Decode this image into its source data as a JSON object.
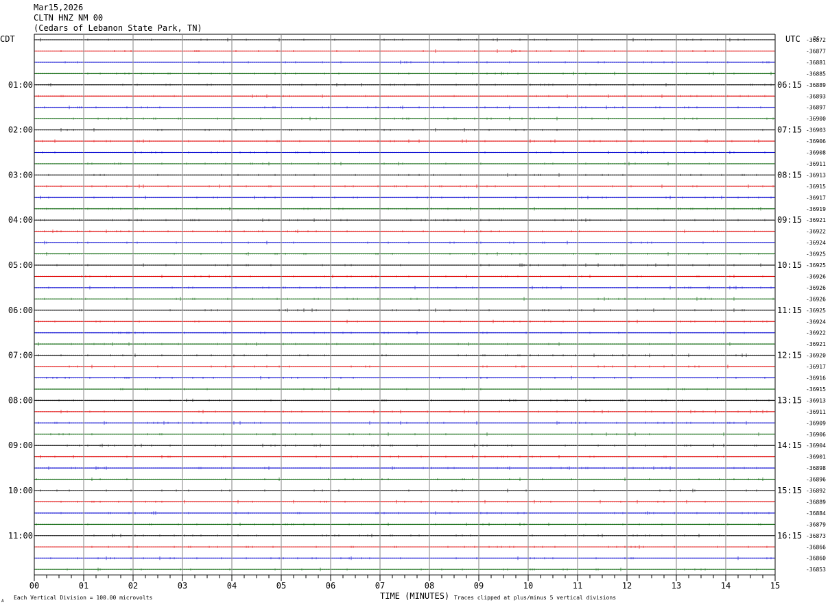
{
  "header": {
    "date": "Mar15,2026",
    "station": "CLTN HNZ NM 00",
    "location": "(Cedars of Lebanon State Park, TN)"
  },
  "labels": {
    "left_tz": "CDT",
    "right_tz": "UTC",
    "dc": "DC",
    "xlabel": "TIME (MINUTES)",
    "scale_note": "Each Vertical Division =  100.00 microvolts",
    "clip_note": "Traces clipped at plus/minus 5 vertical divisions",
    "corner_mark": "A"
  },
  "colors": {
    "trace_cycle": [
      "#000000",
      "#e00000",
      "#0000d0",
      "#006000"
    ],
    "vgrid": "#808080"
  },
  "chart_data": {
    "type": "line",
    "title": "CLTN HNZ NM 00",
    "xlabel": "TIME (MINUTES)",
    "x_ticks": [
      "00",
      "01",
      "02",
      "03",
      "04",
      "05",
      "06",
      "07",
      "08",
      "09",
      "10",
      "11",
      "12",
      "13",
      "14",
      "15"
    ],
    "xlim": [
      0,
      15
    ],
    "row_count": 48,
    "minutes_per_row": 15,
    "left_hour_labels": [
      "01:00",
      "02:00",
      "03:00",
      "04:00",
      "05:00",
      "06:00",
      "07:00",
      "08:00",
      "09:00",
      "10:00",
      "11:00"
    ],
    "right_hour_labels": [
      "06:15",
      "07:15",
      "08:15",
      "09:15",
      "10:15",
      "11:15",
      "12:15",
      "13:15",
      "14:15",
      "15:15",
      "16:15"
    ],
    "dc_offsets": [
      "-36872",
      "-36877",
      "-36881",
      "-36885",
      "-36889",
      "-36893",
      "-36897",
      "-36900",
      "-36903",
      "-36906",
      "-36908",
      "-36911",
      "-36913",
      "-36915",
      "-36917",
      "-36919",
      "-36921",
      "-36922",
      "-36924",
      "-36925",
      "-36925",
      "-36926",
      "-36926",
      "-36926",
      "-36925",
      "-36924",
      "-36922",
      "-36921",
      "-36920",
      "-36917",
      "-36916",
      "-36915",
      "-36913",
      "-36911",
      "-36909",
      "-36906",
      "-36904",
      "-36901",
      "-36898",
      "-36896",
      "-36892",
      "-36889",
      "-36884",
      "-36879",
      "-36873",
      "-36866",
      "-36860",
      "-36853"
    ]
  }
}
